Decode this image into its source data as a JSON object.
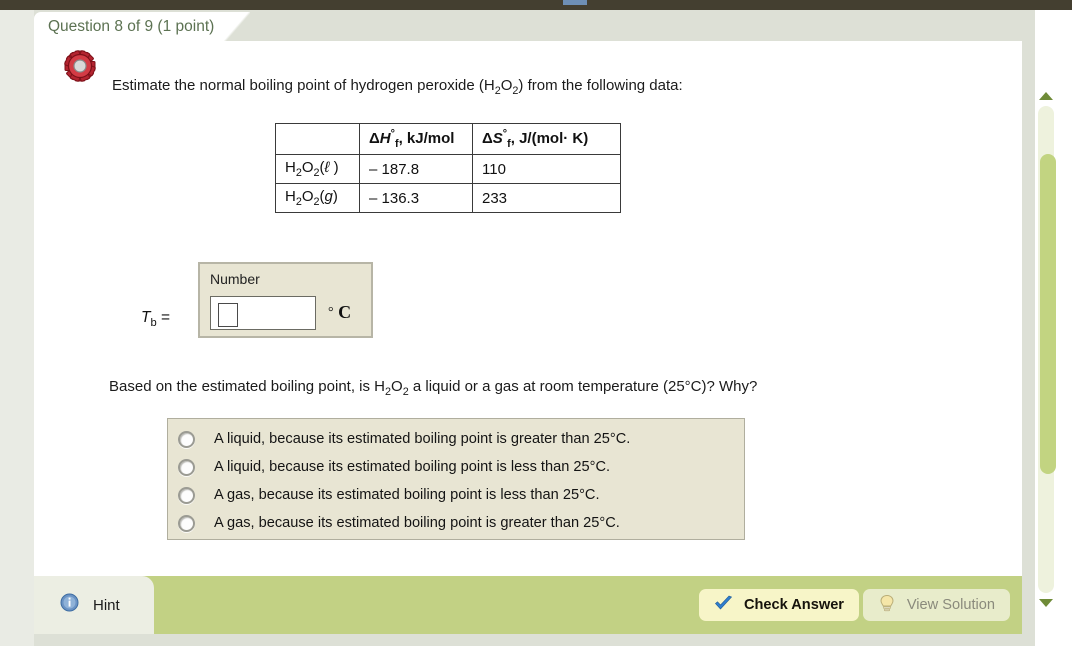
{
  "header": {
    "question_tab": "Question 8 of 9 (1 point)",
    "gear_icon": "gear-icon"
  },
  "main": {
    "prompt_1_prefix": "Estimate the normal boiling point of hydrogen peroxide (H",
    "prompt_1_sub1": "2",
    "prompt_1_mid": "O",
    "prompt_1_sub2": "2",
    "prompt_1_suffix": ") from the following data:",
    "prompt_2_prefix": "Based on the estimated boiling point, is H",
    "prompt_2_sub1": "2",
    "prompt_2_mid": "O",
    "prompt_2_sub2": "2",
    "prompt_2_suffix": " a liquid or a gas at room temperature (25°C)? Why?"
  },
  "table": {
    "headers": {
      "blank": "",
      "delta_h": "ΔH°f, kJ/mol",
      "delta_s": "ΔS°f, J/(mol· K)"
    },
    "rows": [
      {
        "species": "H2O2(ℓ )",
        "state": "ℓ",
        "delta_h": "– 187.8",
        "delta_s": "110"
      },
      {
        "species": "H2O2(g)",
        "state": "g",
        "delta_h": "– 136.3",
        "delta_s": "233"
      }
    ]
  },
  "answer": {
    "tb_label": "Tb =",
    "tb_symbol": "T",
    "tb_sub": "b",
    "tb_equals": " =",
    "number_label": "Number",
    "input_value": "",
    "unit_degree": "°",
    "unit_letter": "C"
  },
  "options": {
    "items": [
      {
        "label": "A liquid, because its estimated boiling point is greater than 25°C.",
        "selected": false
      },
      {
        "label": "A liquid, because its estimated boiling point is less than 25°C.",
        "selected": false
      },
      {
        "label": "A gas, because its estimated boiling point is less than 25°C.",
        "selected": false
      },
      {
        "label": "A gas, because its estimated boiling point is greater than 25°C.",
        "selected": false
      }
    ]
  },
  "footer": {
    "hint_label": "Hint",
    "hint_icon": "info-icon",
    "check_answer_label": "Check Answer",
    "check_answer_icon": "checkmark-icon",
    "view_solution_label": "View Solution",
    "view_solution_icon": "lightbulb-icon"
  },
  "scrollbar": {
    "up_arrow_icon": "triangle-up-icon",
    "down_arrow_icon": "triangle-down-icon"
  },
  "colors": {
    "top_bar": "#443f30",
    "tab_text": "#5c7252",
    "footer_green": "#c2d184",
    "panel_beige": "#e8e5d3",
    "scrollbar_thumb": "#c2d481"
  }
}
